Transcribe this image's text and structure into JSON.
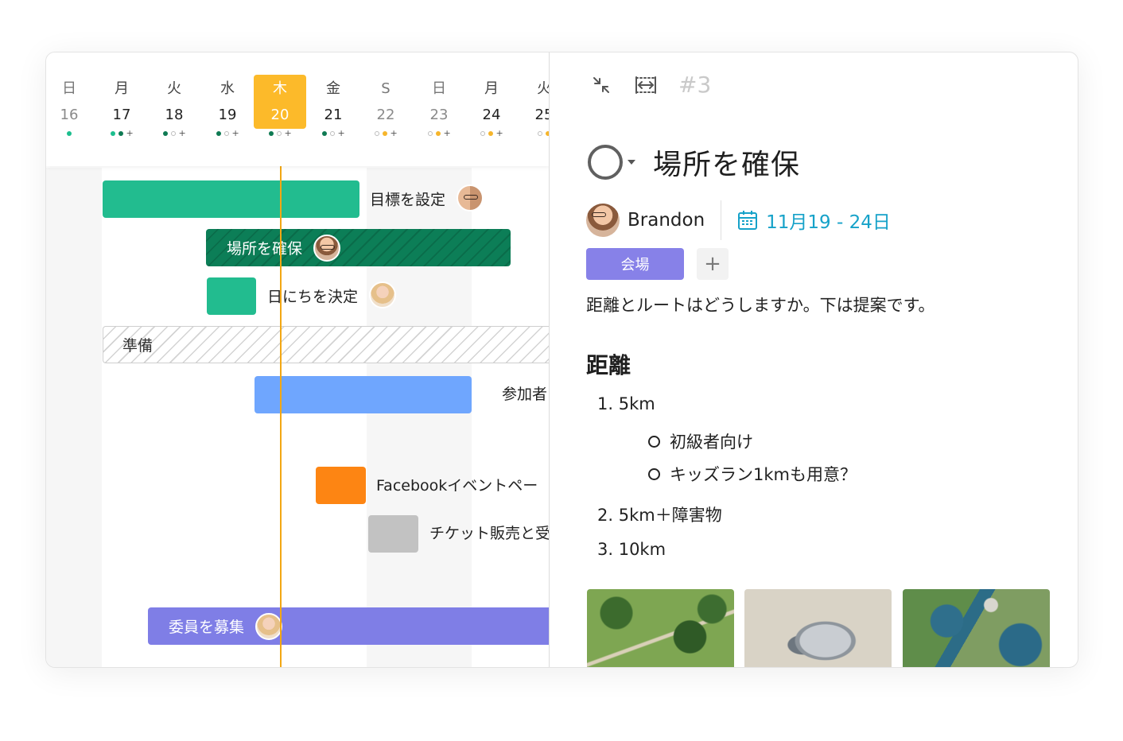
{
  "timeline": {
    "days": [
      {
        "weekday": "日",
        "date": "16",
        "dim": true
      },
      {
        "weekday": "月",
        "date": "17",
        "dim": false
      },
      {
        "weekday": "火",
        "date": "18",
        "dim": false
      },
      {
        "weekday": "水",
        "date": "19",
        "dim": false
      },
      {
        "weekday": "木",
        "date": "20",
        "dim": false,
        "today": true
      },
      {
        "weekday": "金",
        "date": "21",
        "dim": false
      },
      {
        "weekday": "S",
        "date": "22",
        "dim": true
      },
      {
        "weekday": "日",
        "date": "23",
        "dim": true
      },
      {
        "weekday": "月",
        "date": "24",
        "dim": false
      },
      {
        "weekday": "火",
        "date": "25",
        "dim": false
      }
    ],
    "tasks": {
      "goal": "目標を設定",
      "venue": "場所を確保",
      "date": "日にちを決定",
      "prep": "準備",
      "participants": "参加者",
      "facebook": "Facebookイベントペー",
      "tickets": "チケット販売と受",
      "committee": "委員を募集"
    }
  },
  "detail": {
    "task_number": "#3",
    "title": "場所を確保",
    "assignee": "Brandon",
    "date_range": "11月19 - 24日",
    "tag": "会場",
    "add_tag": "+",
    "description": "距離とルートはどうしますか。下は提案です。",
    "section_heading": "距離",
    "list": [
      {
        "label": "1. 5km",
        "sub": [
          "初級者向け",
          "キッズラン1kmも用意？"
        ]
      },
      {
        "label": "2. 5km＋障害物"
      },
      {
        "label": "3. 10km"
      }
    ]
  },
  "colors": {
    "today": "#fcba2a",
    "bar_green": "#22bc8f",
    "bar_dark_green": "#0c7e57",
    "bar_blue": "#6fa6fe",
    "bar_orange": "#fd8513",
    "bar_gray": "#c2c2c2",
    "bar_purple": "#7f7ee6",
    "tag_purple": "#8781e8",
    "date_blue": "#16a2c9"
  }
}
